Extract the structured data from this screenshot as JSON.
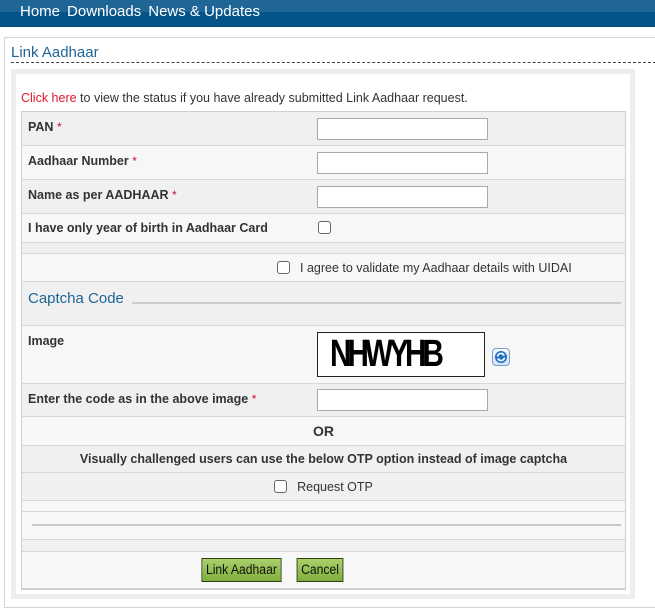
{
  "nav": {
    "items": [
      "Home",
      "Downloads",
      "News & Updates"
    ]
  },
  "page": {
    "title": "Link Aadhaar",
    "status_link": "Click here",
    "status_text": " to view the status if you have already submitted Link Aadhaar request."
  },
  "form": {
    "required_mark": "*",
    "pan": {
      "label": "PAN",
      "value": ""
    },
    "aadhaar_number": {
      "label": "Aadhaar Number",
      "value": ""
    },
    "name_as_per_aadhaar": {
      "label": "Name as per AADHAAR",
      "value": ""
    },
    "year_of_birth_only": {
      "label": "I have only year of birth in Aadhaar Card",
      "checked": false
    },
    "agree_uidai": {
      "label": "I agree to validate my Aadhaar details with UIDAI",
      "checked": false
    },
    "captcha": {
      "section_title": "Captcha Code",
      "image_label": "Image",
      "image_text": "NHWYHB",
      "enter_code_label": "Enter the code as in the above image",
      "value": ""
    },
    "or_label": "OR",
    "otp_note": "Visually challenged users can use the below OTP option instead of image captcha",
    "request_otp": {
      "label": "Request OTP",
      "checked": false
    },
    "buttons": {
      "submit": "Link Aadhaar",
      "cancel": "Cancel"
    }
  },
  "colors": {
    "nav_bg": "#045489",
    "title": "#1f6595",
    "link": "#e0162b",
    "button": "#8fbf4d"
  }
}
